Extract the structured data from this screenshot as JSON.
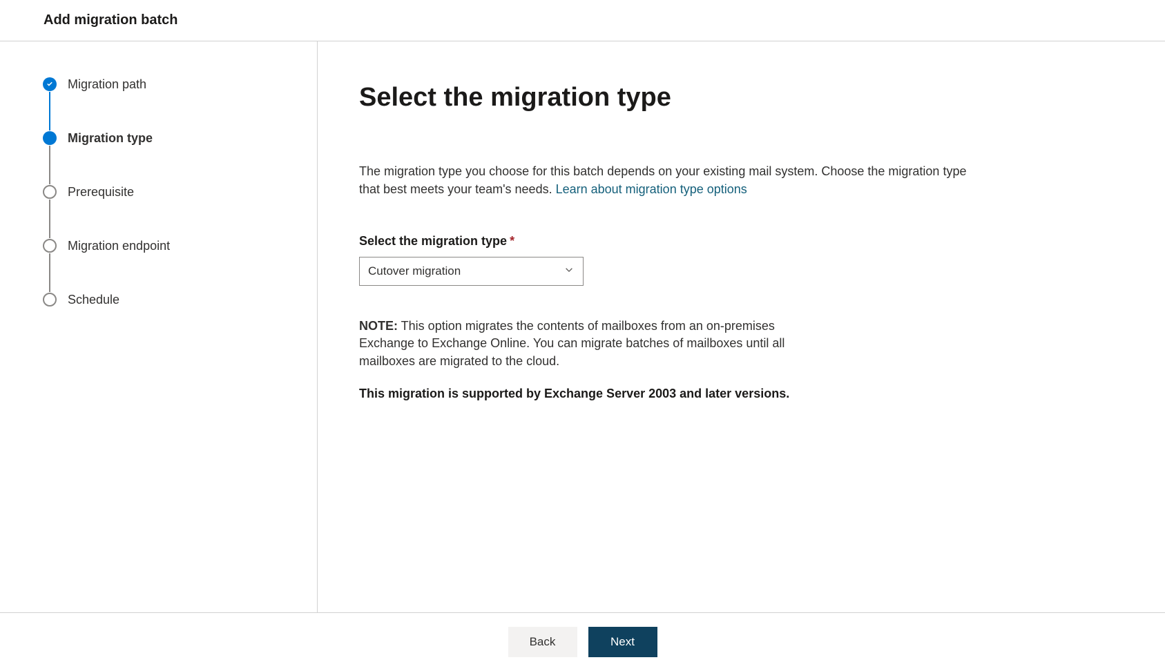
{
  "header": {
    "title": "Add migration batch"
  },
  "steps": [
    {
      "label": "Migration path",
      "state": "completed"
    },
    {
      "label": "Migration type",
      "state": "current"
    },
    {
      "label": "Prerequisite",
      "state": "upcoming"
    },
    {
      "label": "Migration endpoint",
      "state": "upcoming"
    },
    {
      "label": "Schedule",
      "state": "upcoming"
    }
  ],
  "main": {
    "title": "Select the migration type",
    "description_text": "The migration type you choose for this batch depends on your existing mail system. Choose the migration type that best meets your team's needs. ",
    "description_link": "Learn about migration type options",
    "field_label": "Select the migration type",
    "selected_option": "Cutover migration",
    "note_label": "NOTE:",
    "note_text": " This option migrates the contents of mailboxes from an on-premises Exchange to Exchange Online. You can migrate batches of mailboxes until all mailboxes are migrated to the cloud.",
    "support_text": "This migration is supported by Exchange Server 2003 and later versions."
  },
  "footer": {
    "back_label": "Back",
    "next_label": "Next"
  }
}
